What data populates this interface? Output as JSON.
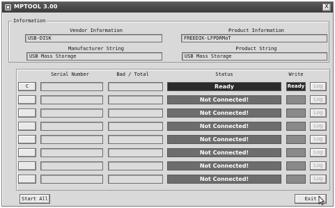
{
  "window": {
    "title": "MPTOOL 3.00",
    "close_label": "X"
  },
  "info": {
    "legend": "Information",
    "vendor_label": "Vendor Information",
    "vendor_value": "USB-DISK",
    "product_label": "Product Information",
    "product_value": "FREEDIK-LFPDRMaT",
    "manufacturer_label": "Manufacturer String",
    "manufacturer_value": "USB Mass Storage",
    "product_string_label": "Product String",
    "product_string_value": "USB Mass Storage"
  },
  "devices": {
    "headers": {
      "serial": "Serial Number",
      "badtotal": "Bad / Total",
      "status": "Status",
      "write": "Write"
    },
    "rows": [
      {
        "slot": "C",
        "status": "Ready",
        "status_type": "ready",
        "write": "Ready",
        "log": "Log"
      },
      {
        "slot": "",
        "status": "Not Connected!",
        "status_type": "notconn",
        "write": "",
        "log": "Log"
      },
      {
        "slot": "",
        "status": "Not Connected!",
        "status_type": "notconn",
        "write": "",
        "log": "Log"
      },
      {
        "slot": "",
        "status": "Not Connected!",
        "status_type": "notconn",
        "write": "",
        "log": "Log"
      },
      {
        "slot": "",
        "status": "Not Connected!",
        "status_type": "notconn",
        "write": "",
        "log": "Log"
      },
      {
        "slot": "",
        "status": "Not Connected!",
        "status_type": "notconn",
        "write": "",
        "log": "Log"
      },
      {
        "slot": "",
        "status": "Not Connected!",
        "status_type": "notconn",
        "write": "",
        "log": "Log"
      },
      {
        "slot": "",
        "status": "Not Connected!",
        "status_type": "notconn",
        "write": "",
        "log": "Log"
      }
    ]
  },
  "footer": {
    "start_all": "Start All",
    "exit": "Exit"
  }
}
